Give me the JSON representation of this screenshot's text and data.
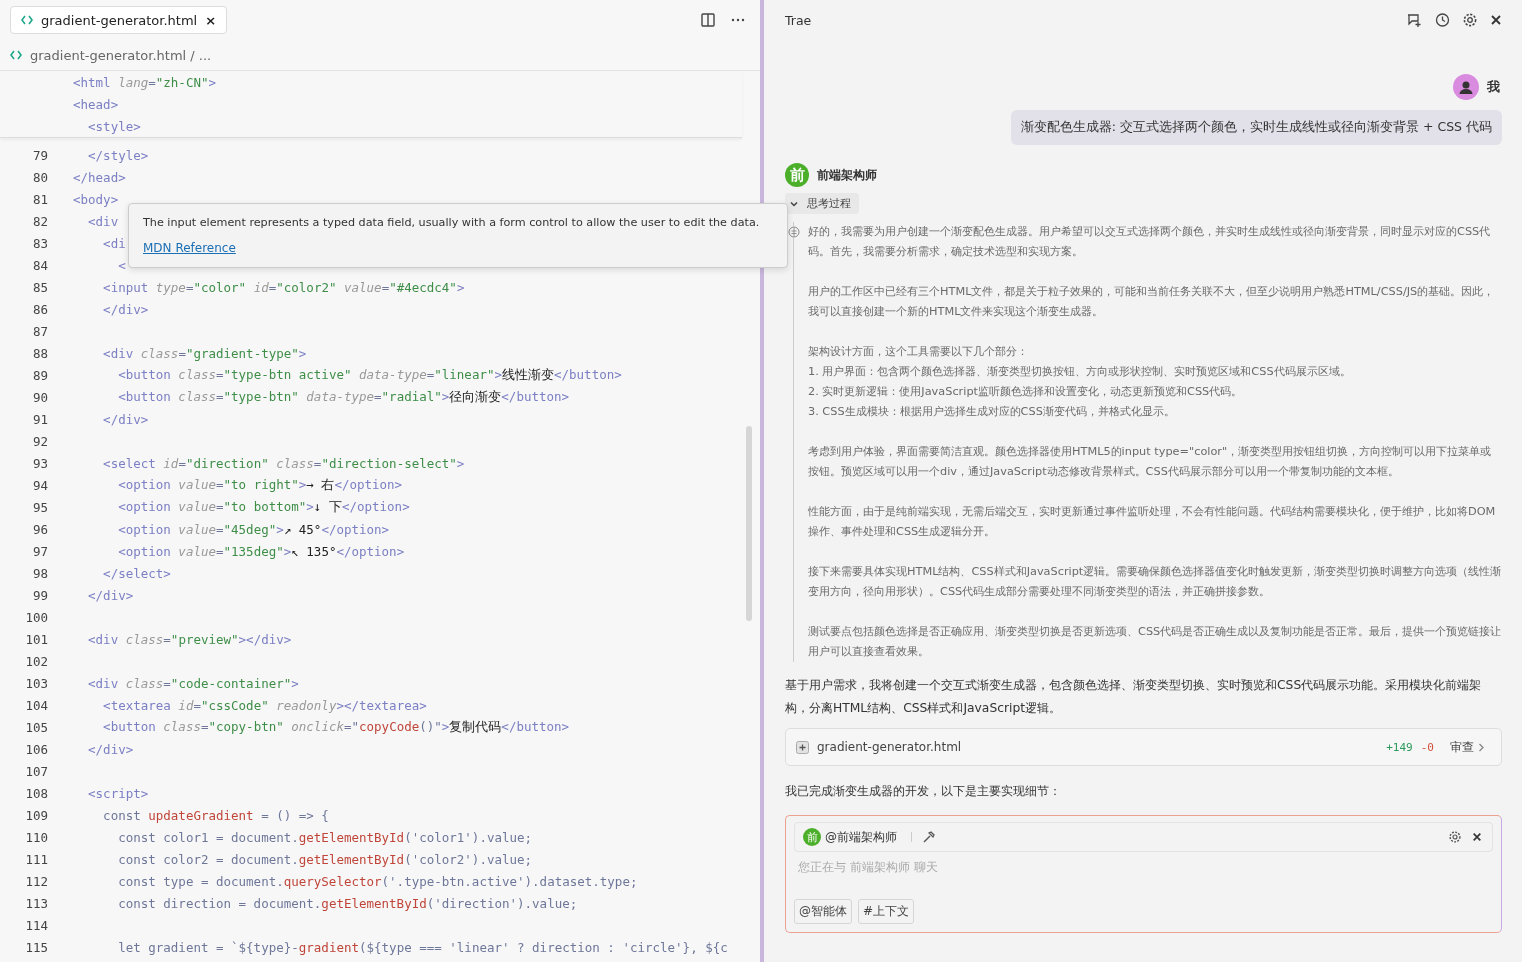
{
  "editor": {
    "tab": {
      "label": "gradient-generator.html",
      "selected": true,
      "close": "×"
    },
    "breadcrumb": "gradient-generator.html / ...",
    "sticky_lines": [
      [
        {
          "kind": "tag",
          "text": "<html "
        },
        {
          "kind": "attr",
          "text": "lang"
        },
        {
          "kind": "p",
          "text": "="
        },
        {
          "kind": "str",
          "text": "\"zh-CN\""
        },
        {
          "kind": "tag",
          "text": ">"
        }
      ],
      [
        {
          "kind": "tag",
          "text": "<head>"
        }
      ],
      [
        {
          "kind": "tag",
          "text": "  <style>"
        }
      ]
    ],
    "lines": [
      {
        "number": "79",
        "tokens": [
          {
            "kind": "tag",
            "text": "  </style>"
          }
        ]
      },
      {
        "number": "80",
        "tokens": [
          {
            "kind": "tag",
            "text": "</head>"
          }
        ]
      },
      {
        "number": "81",
        "tokens": [
          {
            "kind": "tag",
            "text": "<body>"
          }
        ]
      },
      {
        "number": "82",
        "tokens": [
          {
            "kind": "tag",
            "text": "  <div"
          }
        ]
      },
      {
        "number": "83",
        "tokens": [
          {
            "kind": "tag",
            "text": "    <di"
          }
        ]
      },
      {
        "number": "84",
        "tokens": [
          {
            "kind": "tag",
            "text": "      <"
          }
        ]
      },
      {
        "number": "85",
        "tokens": [
          {
            "kind": "tag",
            "text": "    <input "
          },
          {
            "kind": "attr",
            "text": "type"
          },
          {
            "kind": "p",
            "text": "="
          },
          {
            "kind": "str",
            "text": "\"color\" "
          },
          {
            "kind": "attr",
            "text": "id"
          },
          {
            "kind": "p",
            "text": "="
          },
          {
            "kind": "str",
            "text": "\"color2\" "
          },
          {
            "kind": "attr",
            "text": "value"
          },
          {
            "kind": "p",
            "text": "="
          },
          {
            "kind": "str",
            "text": "\"#4ecdc4\""
          },
          {
            "kind": "tag",
            "text": ">"
          }
        ]
      },
      {
        "number": "86",
        "tokens": [
          {
            "kind": "tag",
            "text": "    </div>"
          }
        ]
      },
      {
        "number": "87"
      },
      {
        "number": "88",
        "tokens": [
          {
            "kind": "tag",
            "text": "    <div "
          },
          {
            "kind": "attr",
            "text": "class"
          },
          {
            "kind": "p",
            "text": "="
          },
          {
            "kind": "str",
            "text": "\"gradient-type\""
          },
          {
            "kind": "tag",
            "text": ">"
          }
        ]
      },
      {
        "number": "89",
        "tokens": [
          {
            "kind": "tag",
            "text": "      <button "
          },
          {
            "kind": "attr",
            "text": "class"
          },
          {
            "kind": "p",
            "text": "="
          },
          {
            "kind": "str",
            "text": "\"type-btn active\" "
          },
          {
            "kind": "attr",
            "text": "data-type"
          },
          {
            "kind": "p",
            "text": "="
          },
          {
            "kind": "str",
            "text": "\"linear\""
          },
          {
            "kind": "tag",
            "text": ">"
          },
          {
            "kind": "txt",
            "text": "线性渐变"
          },
          {
            "kind": "tag",
            "text": "</button>"
          }
        ]
      },
      {
        "number": "90",
        "tokens": [
          {
            "kind": "tag",
            "text": "      <button "
          },
          {
            "kind": "attr",
            "text": "class"
          },
          {
            "kind": "p",
            "text": "="
          },
          {
            "kind": "str",
            "text": "\"type-btn\" "
          },
          {
            "kind": "attr",
            "text": "data-type"
          },
          {
            "kind": "p",
            "text": "="
          },
          {
            "kind": "str",
            "text": "\"radial\""
          },
          {
            "kind": "tag",
            "text": ">"
          },
          {
            "kind": "txt",
            "text": "径向渐变"
          },
          {
            "kind": "tag",
            "text": "</button>"
          }
        ]
      },
      {
        "number": "91",
        "tokens": [
          {
            "kind": "tag",
            "text": "    </div>"
          }
        ]
      },
      {
        "number": "92"
      },
      {
        "number": "93",
        "tokens": [
          {
            "kind": "tag",
            "text": "    <select "
          },
          {
            "kind": "attr",
            "text": "id"
          },
          {
            "kind": "p",
            "text": "="
          },
          {
            "kind": "str",
            "text": "\"direction\" "
          },
          {
            "kind": "attr",
            "text": "class"
          },
          {
            "kind": "p",
            "text": "="
          },
          {
            "kind": "str",
            "text": "\"direction-select\""
          },
          {
            "kind": "tag",
            "text": ">"
          }
        ]
      },
      {
        "number": "94",
        "tokens": [
          {
            "kind": "tag",
            "text": "      <option "
          },
          {
            "kind": "attr",
            "text": "value"
          },
          {
            "kind": "p",
            "text": "="
          },
          {
            "kind": "str",
            "text": "\"to right\""
          },
          {
            "kind": "tag",
            "text": ">"
          },
          {
            "kind": "txt",
            "text": "→ 右"
          },
          {
            "kind": "tag",
            "text": "</option>"
          }
        ]
      },
      {
        "number": "95",
        "tokens": [
          {
            "kind": "tag",
            "text": "      <option "
          },
          {
            "kind": "attr",
            "text": "value"
          },
          {
            "kind": "p",
            "text": "="
          },
          {
            "kind": "str",
            "text": "\"to bottom\""
          },
          {
            "kind": "tag",
            "text": ">"
          },
          {
            "kind": "txt",
            "text": "↓ 下"
          },
          {
            "kind": "tag",
            "text": "</option>"
          }
        ]
      },
      {
        "number": "96",
        "tokens": [
          {
            "kind": "tag",
            "text": "      <option "
          },
          {
            "kind": "attr",
            "text": "value"
          },
          {
            "kind": "p",
            "text": "="
          },
          {
            "kind": "str",
            "text": "\"45deg\""
          },
          {
            "kind": "tag",
            "text": ">"
          },
          {
            "kind": "txt",
            "text": "↗ 45°"
          },
          {
            "kind": "tag",
            "text": "</option>"
          }
        ]
      },
      {
        "number": "97",
        "tokens": [
          {
            "kind": "tag",
            "text": "      <option "
          },
          {
            "kind": "attr",
            "text": "value"
          },
          {
            "kind": "p",
            "text": "="
          },
          {
            "kind": "str",
            "text": "\"135deg\""
          },
          {
            "kind": "tag",
            "text": ">"
          },
          {
            "kind": "txt",
            "text": "↖ 135°"
          },
          {
            "kind": "tag",
            "text": "</option>"
          }
        ]
      },
      {
        "number": "98",
        "tokens": [
          {
            "kind": "tag",
            "text": "    </select>"
          }
        ]
      },
      {
        "number": "99",
        "tokens": [
          {
            "kind": "tag",
            "text": "  </div>"
          }
        ]
      },
      {
        "number": "100"
      },
      {
        "number": "101",
        "tokens": [
          {
            "kind": "tag",
            "text": "  <div "
          },
          {
            "kind": "attr",
            "text": "class"
          },
          {
            "kind": "p",
            "text": "="
          },
          {
            "kind": "str",
            "text": "\"preview\""
          },
          {
            "kind": "tag",
            "text": "></div>"
          }
        ]
      },
      {
        "number": "102"
      },
      {
        "number": "103",
        "tokens": [
          {
            "kind": "tag",
            "text": "  <div "
          },
          {
            "kind": "attr",
            "text": "class"
          },
          {
            "kind": "p",
            "text": "="
          },
          {
            "kind": "str",
            "text": "\"code-container\""
          },
          {
            "kind": "tag",
            "text": ">"
          }
        ]
      },
      {
        "number": "104",
        "tokens": [
          {
            "kind": "tag",
            "text": "    <textarea "
          },
          {
            "kind": "attr",
            "text": "id"
          },
          {
            "kind": "p",
            "text": "="
          },
          {
            "kind": "str",
            "text": "\"cssCode\" "
          },
          {
            "kind": "attr",
            "text": "readonly"
          },
          {
            "kind": "tag",
            "text": "></textarea>"
          }
        ]
      },
      {
        "number": "105",
        "tokens": [
          {
            "kind": "tag",
            "text": "    <button "
          },
          {
            "kind": "attr",
            "text": "class"
          },
          {
            "kind": "p",
            "text": "="
          },
          {
            "kind": "str",
            "text": "\"copy-btn\" "
          },
          {
            "kind": "attr",
            "text": "onclick"
          },
          {
            "kind": "p",
            "text": "=\""
          },
          {
            "kind": "fn",
            "text": "copyCode"
          },
          {
            "kind": "p",
            "text": "()\""
          },
          {
            "kind": "tag",
            "text": ">"
          },
          {
            "kind": "txt",
            "text": "复制代码"
          },
          {
            "kind": "tag",
            "text": "</button>"
          }
        ]
      },
      {
        "number": "106",
        "tokens": [
          {
            "kind": "tag",
            "text": "  </div>"
          }
        ]
      },
      {
        "number": "107"
      },
      {
        "number": "108",
        "tokens": [
          {
            "kind": "tag",
            "text": "  <script>"
          }
        ]
      },
      {
        "number": "109",
        "tokens": [
          {
            "kind": "p",
            "text": "    const "
          },
          {
            "kind": "fn",
            "text": "updateGradient"
          },
          {
            "kind": "p",
            "text": " = () => {"
          }
        ]
      },
      {
        "number": "110",
        "tokens": [
          {
            "kind": "p",
            "text": "      const color1 = document."
          },
          {
            "kind": "fn",
            "text": "getElementById"
          },
          {
            "kind": "p",
            "text": "('color1').value;"
          }
        ]
      },
      {
        "number": "111",
        "tokens": [
          {
            "kind": "p",
            "text": "      const color2 = document."
          },
          {
            "kind": "fn",
            "text": "getElementById"
          },
          {
            "kind": "p",
            "text": "('color2').value;"
          }
        ]
      },
      {
        "number": "112",
        "tokens": [
          {
            "kind": "p",
            "text": "      const type = document."
          },
          {
            "kind": "fn",
            "text": "querySelector"
          },
          {
            "kind": "p",
            "text": "('.type-btn.active').dataset.type;"
          }
        ]
      },
      {
        "number": "113",
        "tokens": [
          {
            "kind": "p",
            "text": "      const direction = document."
          },
          {
            "kind": "fn",
            "text": "getElementById"
          },
          {
            "kind": "p",
            "text": "('direction').value;"
          }
        ]
      },
      {
        "number": "114"
      },
      {
        "number": "115",
        "tokens": [
          {
            "kind": "p",
            "text": "      let gradient = `${type}-"
          },
          {
            "kind": "fn",
            "text": "gradient"
          },
          {
            "kind": "p",
            "text": "(${type === 'linear' ? direction : 'circle'}, ${c"
          }
        ]
      }
    ],
    "tooltip": {
      "text": "The input element represents a typed data field, usually with a form control to allow the user to edit the data.",
      "link": "MDN Reference"
    }
  },
  "chat": {
    "title": "Trae",
    "user": {
      "name": "我",
      "message": "渐变配色生成器: 交互式选择两个颜色，实时生成线性或径向渐变背景 + CSS 代码"
    },
    "assistant": {
      "name": "前端架构师",
      "avatar_letter": "前",
      "thinking": {
        "label": "思考过程",
        "expanded": true,
        "paragraphs": [
          "好的，我需要为用户创建一个渐变配色生成器。用户希望可以交互式选择两个颜色，并实时生成线性或径向渐变背景，同时显示对应的CSS代码。首先，我需要分析需求，确定技术选型和实现方案。",
          "用户的工作区中已经有三个HTML文件，都是关于粒子效果的，可能和当前任务关联不大，但至少说明用户熟悉HTML/CSS/JS的基础。因此，我可以直接创建一个新的HTML文件来实现这个渐变生成器。",
          "架构设计方面，这个工具需要以下几个部分：\n1. 用户界面：包含两个颜色选择器、渐变类型切换按钮、方向或形状控制、实时预览区域和CSS代码展示区域。\n2. 实时更新逻辑：使用JavaScript监听颜色选择和设置变化，动态更新预览和CSS代码。\n3. CSS生成模块：根据用户选择生成对应的CSS渐变代码，并格式化显示。",
          "考虑到用户体验，界面需要简洁直观。颜色选择器使用HTML5的input type=\"color\"，渐变类型用按钮组切换，方向控制可以用下拉菜单或按钮。预览区域可以用一个div，通过JavaScript动态修改背景样式。CSS代码展示部分可以用一个带复制功能的文本框。",
          "性能方面，由于是纯前端实现，无需后端交互，实时更新通过事件监听处理，不会有性能问题。代码结构需要模块化，便于维护，比如将DOM操作、事件处理和CSS生成逻辑分开。",
          "接下来需要具体实现HTML结构、CSS样式和JavaScript逻辑。需要确保颜色选择器值变化时触发更新，渐变类型切换时调整方向选项（线性渐变用方向，径向用形状）。CSS代码生成部分需要处理不同渐变类型的语法，并正确拼接参数。",
          "测试要点包括颜色选择是否正确应用、渐变类型切换是否更新选项、CSS代码是否正确生成以及复制功能是否正常。最后，提供一个预览链接让用户可以直接查看效果。"
        ]
      },
      "answer": "基于用户需求，我将创建一个交互式渐变生成器，包含颜色选择、渐变类型切换、实时预览和CSS代码展示功能。采用模块化前端架构，分离HTML结构、CSS样式和JavaScript逻辑。",
      "file": {
        "name": "gradient-generator.html",
        "added": "+149",
        "removed": "-0",
        "action": "审查"
      },
      "followup": "我已完成渐变生成器的开发，以下是主要实现细节："
    },
    "input": {
      "agent_avatar_letter": "前",
      "agent_chip": "@前端架构师",
      "placeholder": "您正在与 前端架构师 聊天",
      "buttons": [
        "@智能体",
        "#上下文"
      ]
    }
  }
}
